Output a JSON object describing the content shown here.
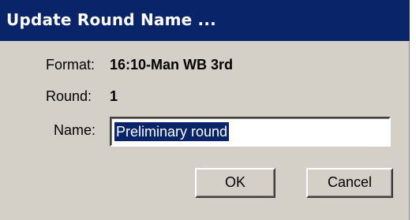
{
  "window": {
    "title": "Update Round Name ..."
  },
  "format": {
    "label": "Format:",
    "value": "16:10-Man WB 3rd"
  },
  "round": {
    "label": "Round:",
    "value": "1"
  },
  "name": {
    "label": "Name:",
    "value": "Preliminary round",
    "selected": true
  },
  "buttons": {
    "ok_label": "OK",
    "cancel_label": "Cancel"
  },
  "colors": {
    "title_bar": "#0a246a",
    "dialog_face": "#d4d0c8",
    "selection_highlight": "#0a246a"
  }
}
